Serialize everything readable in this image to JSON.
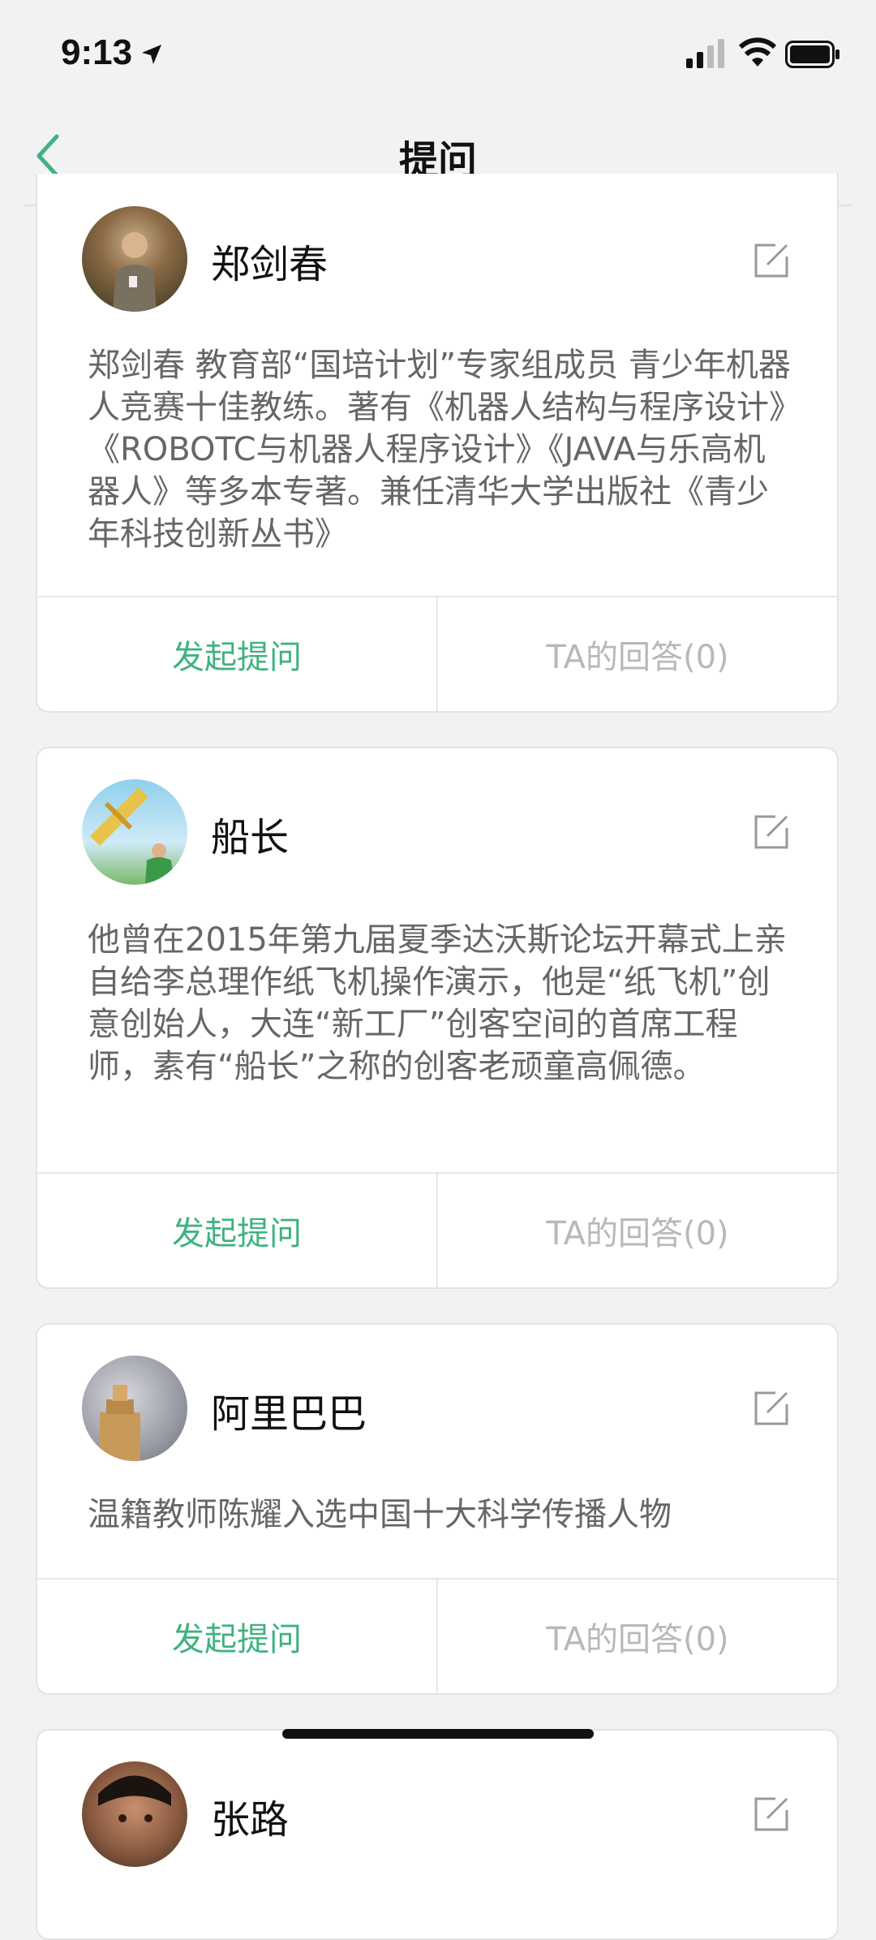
{
  "status_bar": {
    "time": "9:13"
  },
  "nav": {
    "title": "提问"
  },
  "experts": [
    {
      "name": "郑剑春",
      "description": "郑剑春 教育部“国培计划”专家组成员 青少年机器人竞赛十佳教练。著有《机器人结构与程序设计》《ROBOTC与机器人程序设计》《JAVA与乐高机器人》等多本专著。兼任清华大学出版社《青少年科技创新丛书》",
      "ask_label": "发起提问",
      "answers_label": "TA的回答(0)"
    },
    {
      "name": "船长",
      "description": "他曾在2015年第九届夏季达沃斯论坛开幕式上亲自给李总理作纸飞机操作演示，他是“纸飞机”创意创始人，大连“新工厂”创客空间的首席工程师，素有“船长”之称的创客老顽童高佩德。",
      "ask_label": "发起提问",
      "answers_label": "TA的回答(0)"
    },
    {
      "name": "阿里巴巴",
      "description": "温籍教师陈耀入选中国十大科学传播人物",
      "ask_label": "发起提问",
      "answers_label": "TA的回答(0)"
    },
    {
      "name": "张路"
    }
  ],
  "colors": {
    "accent": "#3fb27f",
    "muted": "#b8b8b8",
    "background": "#f2f2f4"
  }
}
